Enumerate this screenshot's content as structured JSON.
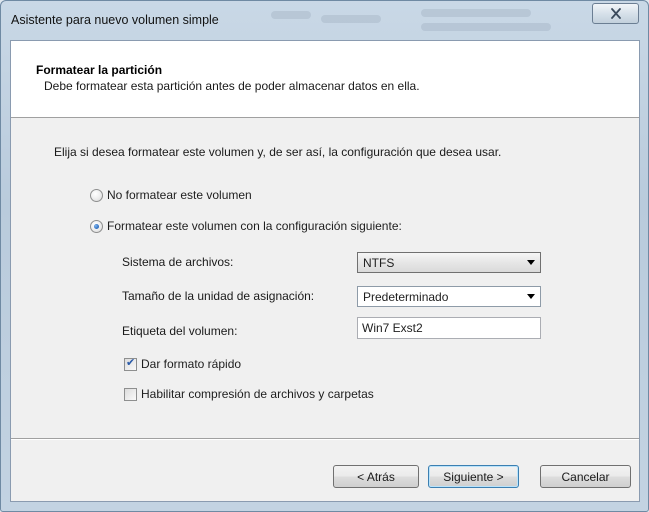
{
  "window": {
    "title": "Asistente para nuevo volumen simple",
    "close_glyph": "✕"
  },
  "header": {
    "title": "Formatear la partición",
    "subtitle": "Debe formatear esta partición antes de poder almacenar datos en ella."
  },
  "intro": "Elija si desea formatear este volumen y, de ser así, la configuración que desea usar.",
  "options": {
    "no_format": {
      "label": "No formatear este volumen",
      "selected": false
    },
    "format": {
      "label": "Formatear este volumen con la configuración siguiente:",
      "selected": true
    }
  },
  "settings": {
    "filesystem": {
      "label": "Sistema de archivos:",
      "value": "NTFS"
    },
    "allocation": {
      "label": "Tamaño de la unidad de asignación:",
      "value": "Predeterminado"
    },
    "volume_label": {
      "label": "Etiqueta del volumen:",
      "value": "Win7 Exst2"
    }
  },
  "checks": {
    "quick_format": {
      "label": "Dar formato rápido",
      "checked": true
    },
    "compression": {
      "label": "Habilitar compresión de archivos y carpetas",
      "checked": false
    }
  },
  "buttons": {
    "back": "< Atrás",
    "next": "Siguiente >",
    "cancel": "Cancelar"
  },
  "colors": {
    "accent": "#1d5fb4",
    "header_bg": "#ffffff",
    "client_bg": "#f0f0f0"
  }
}
